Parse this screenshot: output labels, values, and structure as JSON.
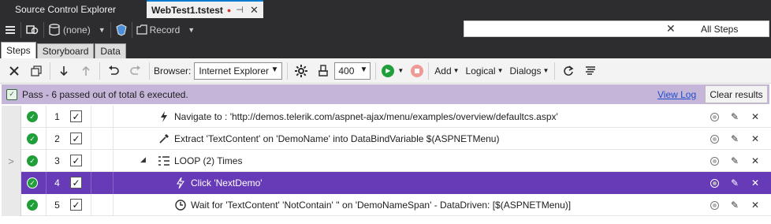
{
  "doc_tabs": {
    "inactive_label": "Source Control Explorer",
    "active_label": "WebTest1.tstest",
    "dirty_mark": "●",
    "pin_glyph": "⊣",
    "close_glyph": "✕"
  },
  "toolbar1": {
    "scheme_value": "(none)",
    "record_label": "Record",
    "search_placeholder": "",
    "search_clear": "✕",
    "search_scope": "All Steps"
  },
  "sub_tabs": [
    "Steps",
    "Storyboard",
    "Data"
  ],
  "toolbar2": {
    "browser_label": "Browser:",
    "browser_value": "Internet Explorer",
    "speed_value": "400",
    "add_label": "Add",
    "logical_label": "Logical",
    "dialogs_label": "Dialogs"
  },
  "result": {
    "text": "Pass - 6 passed out of total 6 executed.",
    "view_log": "View Log",
    "clear_results": "Clear results"
  },
  "steps": [
    {
      "num": "1",
      "desc": "Navigate to : 'http://demos.telerik.com/aspnet-ajax/menu/examples/overview/defaultcs.aspx'",
      "icon": "lightning-icon",
      "checked": "✓",
      "handle": ""
    },
    {
      "num": "2",
      "desc": "Extract 'TextContent' on 'DemoName' into DataBindVariable $(ASPNETMenu)",
      "icon": "eyedropper-icon",
      "checked": "✓",
      "handle": ""
    },
    {
      "num": "3",
      "desc": "LOOP (2) Times",
      "icon": "loop-icon",
      "checked": "✓",
      "handle": ">",
      "expander": "◢"
    },
    {
      "num": "4",
      "desc": "Click 'NextDemo'",
      "icon": "lightning-icon",
      "checked": "✓",
      "handle": "",
      "selected": true
    },
    {
      "num": "5",
      "desc": "Wait for 'TextContent' 'NotContain' '' on 'DemoNameSpan' - DataDriven: [$(ASPNETMenu)]",
      "icon": "clock-icon",
      "checked": "✓",
      "handle": ""
    }
  ],
  "colors": {
    "selected_row": "#673ab7",
    "result_bar": "#c5b6d9",
    "pass_green": "#1f9e3a"
  }
}
